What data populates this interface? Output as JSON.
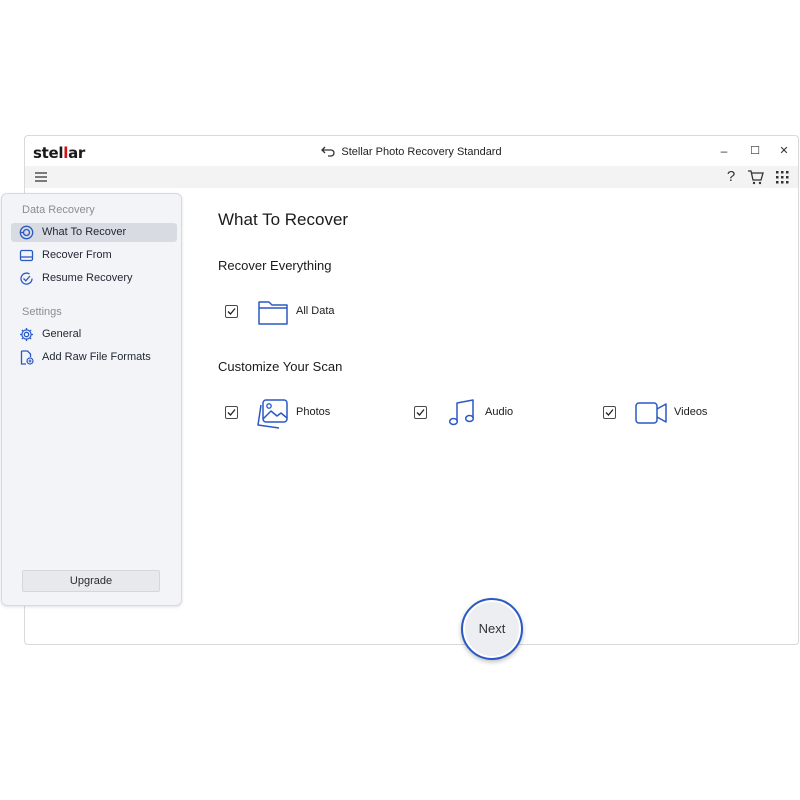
{
  "app": {
    "logo_prefix": "stel",
    "logo_accent": "l",
    "logo_suffix": "ar",
    "title": "Stellar Photo Recovery Standard",
    "brand_color": "#d0121b",
    "accent_color": "#2b59c3"
  },
  "window_controls": {
    "minimize": "–",
    "maximize": "☐",
    "close": "✕"
  },
  "toolbar": {
    "help": "?"
  },
  "sidebar": {
    "data_recovery_heading": "Data Recovery",
    "items": [
      {
        "label": "What To Recover",
        "icon": "target-disc-icon",
        "active": true
      },
      {
        "label": "Recover From",
        "icon": "drive-icon",
        "active": false
      },
      {
        "label": "Resume Recovery",
        "icon": "resume-check-icon",
        "active": false
      }
    ],
    "settings_heading": "Settings",
    "settings_items": [
      {
        "label": "General",
        "icon": "gear-icon"
      },
      {
        "label": "Add Raw File Formats",
        "icon": "file-add-icon"
      }
    ],
    "upgrade_label": "Upgrade"
  },
  "main": {
    "title": "What To Recover",
    "recover_everything": "Recover Everything",
    "all_data": {
      "label": "All Data",
      "checked": true,
      "icon": "folder-icon"
    },
    "customize": "Customize Your Scan",
    "options": [
      {
        "label": "Photos",
        "checked": true,
        "icon": "photos-icon"
      },
      {
        "label": "Audio",
        "checked": true,
        "icon": "music-note-icon"
      },
      {
        "label": "Videos",
        "checked": true,
        "icon": "video-camera-icon"
      }
    ]
  },
  "next_label": "Next"
}
